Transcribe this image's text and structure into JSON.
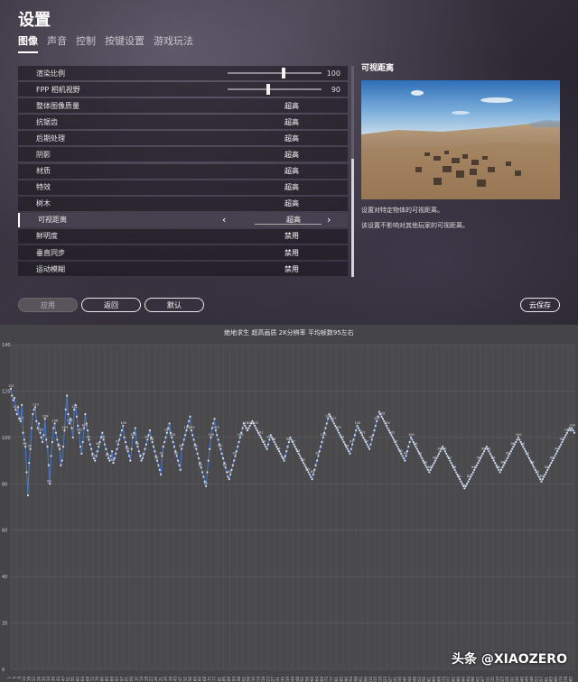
{
  "settings": {
    "title": "设置",
    "tabs": [
      "图像",
      "声音",
      "控制",
      "按键设置",
      "游戏玩法"
    ],
    "active_tab": 0,
    "rows": [
      {
        "label": "渲染比例",
        "kind": "slider",
        "value": "100",
        "level": 0.62
      },
      {
        "label": "FPP 相机视野",
        "kind": "slider",
        "value": "90",
        "level": 0.45
      },
      {
        "label": "整体图像质量",
        "kind": "value",
        "value": "超高"
      },
      {
        "label": "抗锯齿",
        "kind": "value",
        "value": "超高"
      },
      {
        "label": "后期处理",
        "kind": "value",
        "value": "超高"
      },
      {
        "label": "阴影",
        "kind": "value",
        "value": "超高"
      },
      {
        "label": "材质",
        "kind": "value",
        "value": "超高"
      },
      {
        "label": "特效",
        "kind": "value",
        "value": "超高"
      },
      {
        "label": "树木",
        "kind": "value",
        "value": "超高"
      },
      {
        "label": "可视距离",
        "kind": "selector",
        "value": "超高",
        "selected": true
      },
      {
        "label": "鲜明度",
        "kind": "value",
        "value": "禁用"
      },
      {
        "label": "垂直同步",
        "kind": "value",
        "value": "禁用"
      },
      {
        "label": "运动模糊",
        "kind": "value",
        "value": "禁用"
      }
    ],
    "detail": {
      "title": "可视距离",
      "line1": "设置对特定物体的可视距离。",
      "line2": "该设置不影响对其他玩家的可视距离。"
    },
    "buttons": {
      "apply": "应用",
      "back": "返回",
      "default": "默认",
      "cloud_save": "云保存"
    },
    "colors": {
      "accent": "#ffffff",
      "row_bg": "#1a1820",
      "selected_bg": "#46424f"
    }
  },
  "chart": {
    "title": "绝地求生 超高画质 2K分辨率 平均帧数95左右",
    "watermark": "头条 @XIAOZERO"
  },
  "chart_data": {
    "type": "line",
    "title": "绝地求生 超高画质 2K分辨率 平均帧数95左右",
    "xlabel": "",
    "ylabel": "",
    "ylim": [
      0,
      140
    ],
    "yticks": [
      0,
      20,
      40,
      60,
      80,
      100,
      120,
      140
    ],
    "x_range": [
      1,
      484
    ],
    "grid": true,
    "series": [
      {
        "color": "#4a78c8",
        "values": [
          121,
          118,
          116,
          117,
          112,
          110,
          113,
          108,
          107,
          114,
          102,
          99,
          96,
          85,
          75,
          89,
          95,
          104,
          110,
          112,
          113,
          107,
          104,
          106,
          102,
          100,
          98,
          101,
          108,
          99,
          96,
          88,
          80,
          92,
          98,
          104,
          106,
          102,
          99,
          97,
          95,
          88,
          90,
          96,
          103,
          112,
          118,
          110,
          106,
          108,
          104,
          100,
          112,
          114,
          109,
          105,
          102,
          96,
          93,
          98,
          104,
          110,
          106,
          103,
          99,
          97,
          95,
          93,
          91,
          90,
          92,
          94,
          96,
          98,
          100,
          102,
          99,
          97,
          95,
          93,
          91,
          90,
          92,
          94,
          89,
          91,
          93,
          95,
          97,
          99,
          101,
          103,
          105,
          100,
          98,
          96,
          94,
          92,
          90,
          95,
          100,
          102,
          104,
          98,
          96,
          94,
          92,
          90,
          91,
          93,
          95,
          97,
          99,
          101,
          103,
          100,
          98,
          96,
          94,
          92,
          90,
          88,
          86,
          84,
          92,
          96,
          98,
          100,
          102,
          104,
          106,
          102,
          100,
          98,
          96,
          94,
          92,
          90,
          88,
          86,
          95,
          97,
          99,
          101,
          103,
          105,
          107,
          109,
          103,
          101,
          99,
          97,
          95,
          93,
          91,
          89,
          87,
          85,
          83,
          81,
          79,
          85,
          90,
          95,
          100,
          104,
          106,
          108,
          103,
          101,
          99,
          97,
          95,
          93,
          91,
          89,
          87,
          85,
          83,
          82,
          84,
          86,
          88,
          90,
          92,
          94,
          96,
          98,
          100,
          102,
          104,
          106,
          105,
          104,
          103,
          104,
          105,
          106,
          107,
          106,
          105,
          104,
          103,
          102,
          101,
          100,
          99,
          98,
          97,
          96,
          95,
          97,
          99,
          101,
          100,
          99,
          98,
          97,
          96,
          95,
          94,
          93,
          92,
          91,
          90,
          92,
          94,
          96,
          98,
          100,
          99,
          98,
          97,
          96,
          95,
          94,
          93,
          92,
          91,
          90,
          89,
          88,
          87,
          86,
          85,
          84,
          83,
          82,
          84,
          86,
          88,
          90,
          92,
          94,
          96,
          98,
          100,
          102,
          104,
          106,
          108,
          110,
          109,
          108,
          107,
          106,
          105,
          104,
          103,
          102,
          101,
          100,
          99,
          98,
          97,
          96,
          95,
          94,
          93,
          95,
          97,
          99,
          101,
          103,
          105,
          104,
          103,
          102,
          101,
          100,
          99,
          98,
          97,
          96,
          95,
          97,
          99,
          101,
          103,
          105,
          107,
          109,
          111,
          110,
          109,
          108,
          107,
          106,
          105,
          104,
          103,
          102,
          101,
          100,
          99,
          98,
          97,
          96,
          95,
          94,
          93,
          92,
          91,
          90,
          92,
          94,
          96,
          98,
          100,
          99,
          98,
          97,
          96,
          95,
          94,
          93,
          92,
          91,
          90,
          89,
          88,
          87,
          86,
          85,
          86,
          87,
          88,
          89,
          90,
          91,
          92,
          93,
          94,
          95,
          96,
          95,
          94,
          93,
          92,
          91,
          90,
          89,
          88,
          87,
          86,
          85,
          84,
          83,
          82,
          81,
          80,
          79,
          78,
          79,
          80,
          81,
          82,
          83,
          84,
          85,
          86,
          87,
          88,
          89,
          90,
          91,
          92,
          93,
          94,
          95,
          96,
          95,
          94,
          93,
          92,
          91,
          90,
          89,
          88,
          87,
          86,
          85,
          86,
          87,
          88,
          89,
          90,
          91,
          92,
          93,
          94,
          95,
          96,
          97,
          98,
          99,
          100,
          99,
          98,
          97,
          96,
          95,
          94,
          93,
          92,
          91,
          90,
          89,
          88,
          87,
          86,
          85,
          84,
          83,
          82,
          81,
          82,
          83,
          84,
          85,
          86,
          87,
          88,
          89,
          90,
          91,
          92,
          93,
          94,
          95,
          96,
          97,
          98,
          99,
          100,
          101,
          102,
          103,
          104,
          103,
          104,
          103,
          102
        ]
      }
    ]
  }
}
